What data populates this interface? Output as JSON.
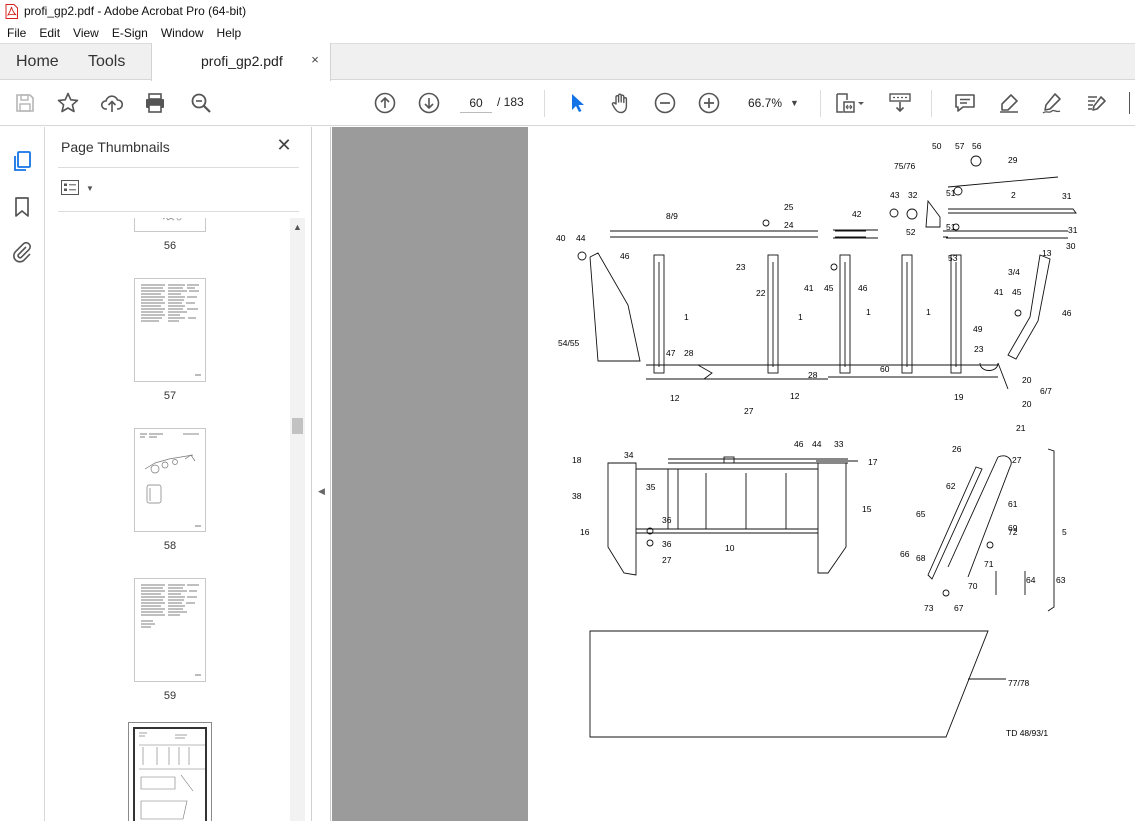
{
  "window": {
    "title": "profi_gp2.pdf - Adobe Acrobat Pro (64-bit)"
  },
  "menu": [
    "File",
    "Edit",
    "View",
    "E-Sign",
    "Window",
    "Help"
  ],
  "tabs": {
    "home": "Home",
    "tools": "Tools",
    "document": "profi_gp2.pdf",
    "close": "×"
  },
  "toolbar": {
    "page_current": "60",
    "page_total": "/ 183",
    "zoom": "66.7%",
    "icons": [
      "save-icon",
      "star-icon",
      "upload-icon",
      "print-icon",
      "zoom-search-icon",
      "page-up-icon",
      "page-down-icon",
      "select-cursor-icon",
      "hand-icon",
      "zoom-out-icon",
      "zoom-in-icon",
      "fit-page-icon",
      "scroll-mode-icon",
      "comment-icon",
      "highlight-icon",
      "sign-icon",
      "edit-icon"
    ]
  },
  "sidebar": {
    "panel_title": "Page Thumbnails",
    "close": "✕",
    "thumbnails": [
      {
        "label": "56"
      },
      {
        "label": "57"
      },
      {
        "label": "58"
      },
      {
        "label": "59"
      },
      {
        "label": ""
      }
    ]
  },
  "diagram": {
    "labels": [
      "50",
      "57",
      "56",
      "75/76",
      "29",
      "43",
      "32",
      "51",
      "2",
      "31",
      "42",
      "8/9",
      "25",
      "24",
      "52",
      "51",
      "31",
      "30",
      "40",
      "44",
      "46",
      "23",
      "22",
      "41",
      "45",
      "46",
      "53",
      "13",
      "3/4",
      "1",
      "1",
      "1",
      "1",
      "54/55",
      "47",
      "28",
      "28",
      "60",
      "41",
      "45",
      "46",
      "49",
      "23",
      "20",
      "6/7",
      "12",
      "27",
      "12",
      "19",
      "20",
      "21",
      "18",
      "34",
      "46",
      "44",
      "33",
      "17",
      "38",
      "35",
      "36",
      "15",
      "16",
      "36",
      "10",
      "27",
      "26",
      "27",
      "62",
      "61",
      "65",
      "69",
      "72",
      "5",
      "66",
      "68",
      "71",
      "70",
      "64",
      "63",
      "73",
      "67",
      "77/78",
      "TD 48/93/1"
    ]
  },
  "colors": {
    "doc_background": "#9b9b9b",
    "toolbar_icon": "#5a5a5a",
    "select_active": "#1473e6",
    "pdf_red": "#d4251c"
  }
}
